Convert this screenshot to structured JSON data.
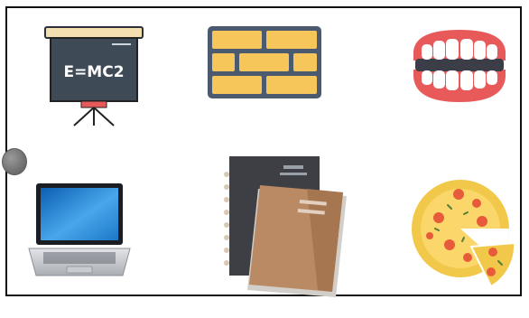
{
  "board": {
    "cards": [
      {
        "icon": "chalkboard-icon",
        "text": "E=MC2"
      },
      {
        "icon": "brick-wall-icon"
      },
      {
        "icon": "teeth-icon"
      },
      {
        "icon": "laptop-icon"
      },
      {
        "icon": "notebooks-icon"
      },
      {
        "icon": "pizza-icon"
      }
    ]
  },
  "colors": {
    "board": "#3f4a57",
    "brick": "#f7c65a",
    "teeth_gum": "#e85a5a",
    "notebook_dark": "#3d3f44",
    "notebook_brown": "#b98a63",
    "pizza_crust": "#f2c84b",
    "pepperoni": "#e85b3a"
  }
}
